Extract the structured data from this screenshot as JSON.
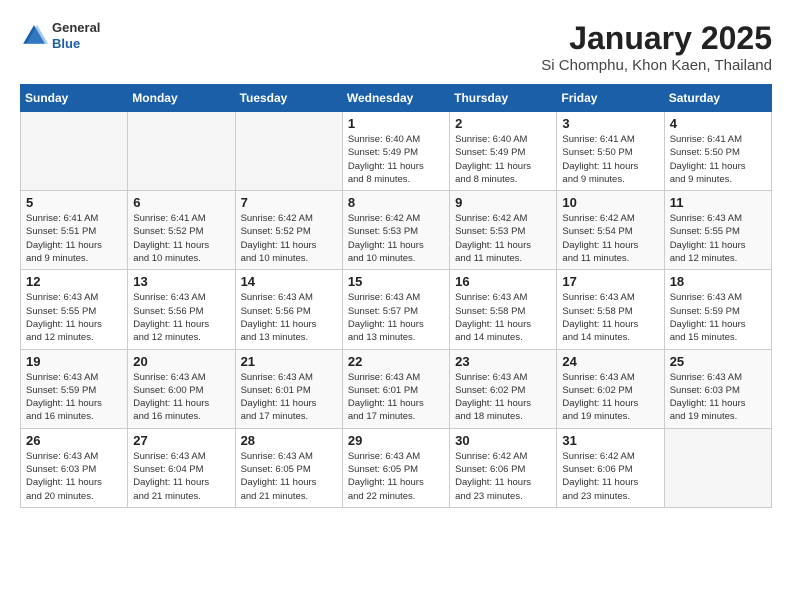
{
  "logo": {
    "general": "General",
    "blue": "Blue"
  },
  "title": "January 2025",
  "subtitle": "Si Chomphu, Khon Kaen, Thailand",
  "days_of_week": [
    "Sunday",
    "Monday",
    "Tuesday",
    "Wednesday",
    "Thursday",
    "Friday",
    "Saturday"
  ],
  "weeks": [
    [
      {
        "day": "",
        "info": ""
      },
      {
        "day": "",
        "info": ""
      },
      {
        "day": "",
        "info": ""
      },
      {
        "day": "1",
        "info": "Sunrise: 6:40 AM\nSunset: 5:49 PM\nDaylight: 11 hours\nand 8 minutes."
      },
      {
        "day": "2",
        "info": "Sunrise: 6:40 AM\nSunset: 5:49 PM\nDaylight: 11 hours\nand 8 minutes."
      },
      {
        "day": "3",
        "info": "Sunrise: 6:41 AM\nSunset: 5:50 PM\nDaylight: 11 hours\nand 9 minutes."
      },
      {
        "day": "4",
        "info": "Sunrise: 6:41 AM\nSunset: 5:50 PM\nDaylight: 11 hours\nand 9 minutes."
      }
    ],
    [
      {
        "day": "5",
        "info": "Sunrise: 6:41 AM\nSunset: 5:51 PM\nDaylight: 11 hours\nand 9 minutes."
      },
      {
        "day": "6",
        "info": "Sunrise: 6:41 AM\nSunset: 5:52 PM\nDaylight: 11 hours\nand 10 minutes."
      },
      {
        "day": "7",
        "info": "Sunrise: 6:42 AM\nSunset: 5:52 PM\nDaylight: 11 hours\nand 10 minutes."
      },
      {
        "day": "8",
        "info": "Sunrise: 6:42 AM\nSunset: 5:53 PM\nDaylight: 11 hours\nand 10 minutes."
      },
      {
        "day": "9",
        "info": "Sunrise: 6:42 AM\nSunset: 5:53 PM\nDaylight: 11 hours\nand 11 minutes."
      },
      {
        "day": "10",
        "info": "Sunrise: 6:42 AM\nSunset: 5:54 PM\nDaylight: 11 hours\nand 11 minutes."
      },
      {
        "day": "11",
        "info": "Sunrise: 6:43 AM\nSunset: 5:55 PM\nDaylight: 11 hours\nand 12 minutes."
      }
    ],
    [
      {
        "day": "12",
        "info": "Sunrise: 6:43 AM\nSunset: 5:55 PM\nDaylight: 11 hours\nand 12 minutes."
      },
      {
        "day": "13",
        "info": "Sunrise: 6:43 AM\nSunset: 5:56 PM\nDaylight: 11 hours\nand 12 minutes."
      },
      {
        "day": "14",
        "info": "Sunrise: 6:43 AM\nSunset: 5:56 PM\nDaylight: 11 hours\nand 13 minutes."
      },
      {
        "day": "15",
        "info": "Sunrise: 6:43 AM\nSunset: 5:57 PM\nDaylight: 11 hours\nand 13 minutes."
      },
      {
        "day": "16",
        "info": "Sunrise: 6:43 AM\nSunset: 5:58 PM\nDaylight: 11 hours\nand 14 minutes."
      },
      {
        "day": "17",
        "info": "Sunrise: 6:43 AM\nSunset: 5:58 PM\nDaylight: 11 hours\nand 14 minutes."
      },
      {
        "day": "18",
        "info": "Sunrise: 6:43 AM\nSunset: 5:59 PM\nDaylight: 11 hours\nand 15 minutes."
      }
    ],
    [
      {
        "day": "19",
        "info": "Sunrise: 6:43 AM\nSunset: 5:59 PM\nDaylight: 11 hours\nand 16 minutes."
      },
      {
        "day": "20",
        "info": "Sunrise: 6:43 AM\nSunset: 6:00 PM\nDaylight: 11 hours\nand 16 minutes."
      },
      {
        "day": "21",
        "info": "Sunrise: 6:43 AM\nSunset: 6:01 PM\nDaylight: 11 hours\nand 17 minutes."
      },
      {
        "day": "22",
        "info": "Sunrise: 6:43 AM\nSunset: 6:01 PM\nDaylight: 11 hours\nand 17 minutes."
      },
      {
        "day": "23",
        "info": "Sunrise: 6:43 AM\nSunset: 6:02 PM\nDaylight: 11 hours\nand 18 minutes."
      },
      {
        "day": "24",
        "info": "Sunrise: 6:43 AM\nSunset: 6:02 PM\nDaylight: 11 hours\nand 19 minutes."
      },
      {
        "day": "25",
        "info": "Sunrise: 6:43 AM\nSunset: 6:03 PM\nDaylight: 11 hours\nand 19 minutes."
      }
    ],
    [
      {
        "day": "26",
        "info": "Sunrise: 6:43 AM\nSunset: 6:03 PM\nDaylight: 11 hours\nand 20 minutes."
      },
      {
        "day": "27",
        "info": "Sunrise: 6:43 AM\nSunset: 6:04 PM\nDaylight: 11 hours\nand 21 minutes."
      },
      {
        "day": "28",
        "info": "Sunrise: 6:43 AM\nSunset: 6:05 PM\nDaylight: 11 hours\nand 21 minutes."
      },
      {
        "day": "29",
        "info": "Sunrise: 6:43 AM\nSunset: 6:05 PM\nDaylight: 11 hours\nand 22 minutes."
      },
      {
        "day": "30",
        "info": "Sunrise: 6:42 AM\nSunset: 6:06 PM\nDaylight: 11 hours\nand 23 minutes."
      },
      {
        "day": "31",
        "info": "Sunrise: 6:42 AM\nSunset: 6:06 PM\nDaylight: 11 hours\nand 23 minutes."
      },
      {
        "day": "",
        "info": ""
      }
    ]
  ]
}
